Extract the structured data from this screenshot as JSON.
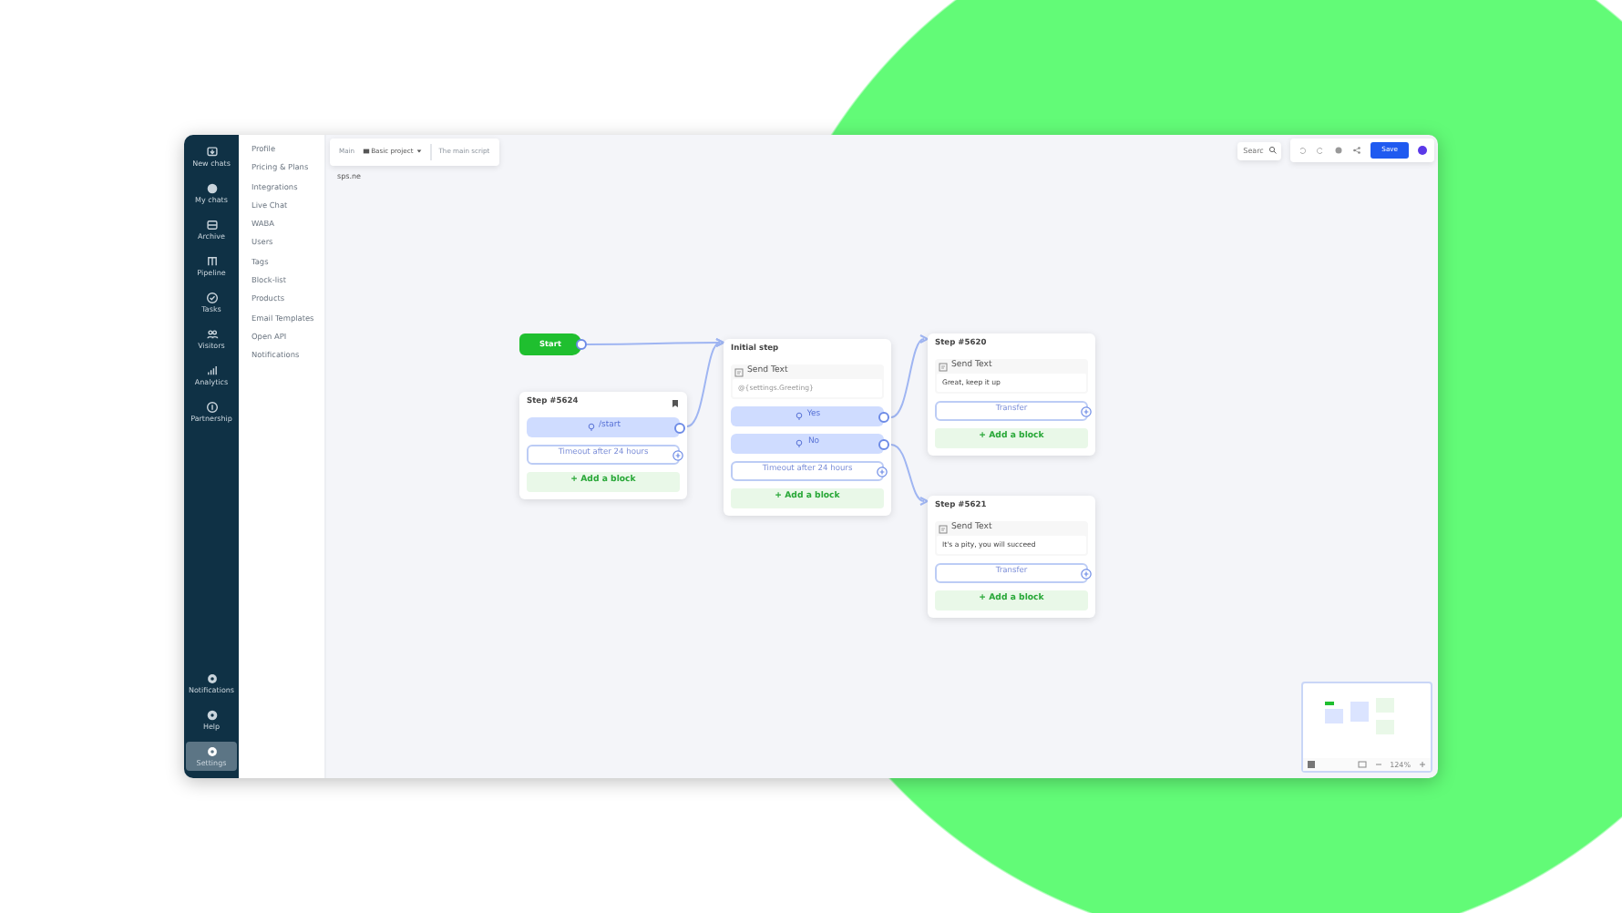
{
  "sidebar": {
    "items": [
      {
        "label": "New chats",
        "selected": false
      },
      {
        "label": "My chats",
        "selected": false
      },
      {
        "label": "Archive",
        "selected": false
      },
      {
        "label": "Pipeline",
        "selected": false
      },
      {
        "label": "Tasks",
        "selected": false
      },
      {
        "label": "Visitors",
        "selected": false
      },
      {
        "label": "Analytics",
        "selected": false
      },
      {
        "label": "Partnership",
        "selected": false
      }
    ],
    "bottom_items": [
      {
        "label": "Notifications",
        "selected": false
      },
      {
        "label": "Help",
        "selected": false
      },
      {
        "label": "Settings",
        "selected": true
      }
    ]
  },
  "settings_menu": {
    "items": [
      "Profile",
      "Pricing & Plans",
      "Integrations",
      "Live Chat",
      "WABA",
      "Users",
      "Tags",
      "Block-list",
      "Products",
      "Email Templates",
      "Open API",
      "Notifications"
    ]
  },
  "toolbar": {
    "breadcrumb": [
      "Main",
      "Basic project",
      "The main script"
    ],
    "subtitle": "sps.ne",
    "search": {
      "placeholder": "Searc"
    },
    "save": "Save"
  },
  "nodes": [
    {
      "kind": "start",
      "label": "Start"
    },
    {
      "kind": "step",
      "title": "Step #5624",
      "bookmark": true,
      "blocks": [
        {
          "kind": "trigger",
          "text": "/start"
        },
        {
          "kind": "timeout",
          "text": "Timeout after 24 hours"
        }
      ],
      "add": "+ Add a block"
    },
    {
      "kind": "step",
      "title": "Initial step",
      "bookmark": false,
      "blocks": [
        {
          "kind": "message",
          "title": "Send Text",
          "text": "@{settings.Greeting}"
        },
        {
          "kind": "trigger",
          "text": "Yes"
        },
        {
          "kind": "trigger",
          "text": "No"
        },
        {
          "kind": "timeout",
          "text": "Timeout after 24 hours"
        }
      ],
      "add": "+ Add a block"
    },
    {
      "kind": "step",
      "title": "Step #5620",
      "bookmark": false,
      "blocks": [
        {
          "kind": "message",
          "title": "Send Text",
          "text": "Great, keep it up"
        },
        {
          "kind": "timeout",
          "text": "Transfer"
        }
      ],
      "add": "+ Add a block"
    },
    {
      "kind": "step",
      "title": "Step #5621",
      "bookmark": false,
      "blocks": [
        {
          "kind": "message",
          "title": "Send Text",
          "text": "It's a pity, you will succeed"
        },
        {
          "kind": "timeout",
          "text": "Transfer"
        }
      ],
      "add": "+ Add a block"
    }
  ],
  "minimap": {
    "zoom": "124%"
  }
}
